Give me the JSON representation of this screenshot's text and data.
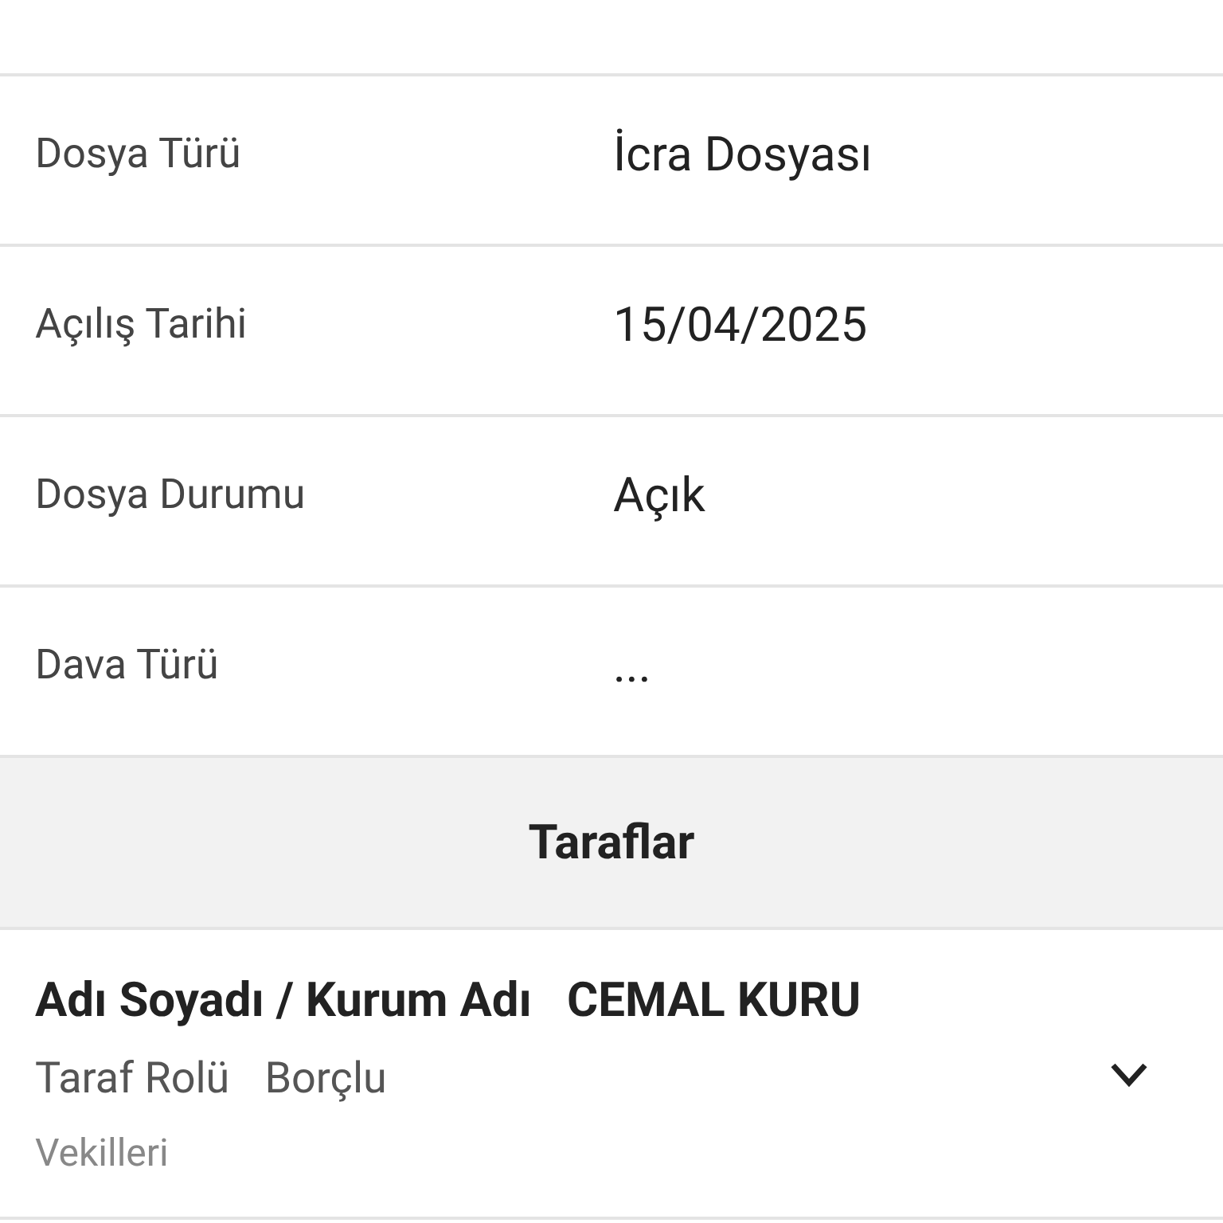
{
  "details": [
    {
      "label": "Dosya Türü",
      "value": "İcra Dosyası"
    },
    {
      "label": "Açılış Tarihi",
      "value": "15/04/2025"
    },
    {
      "label": "Dosya Durumu",
      "value": "Açık"
    },
    {
      "label": "Dava Türü",
      "value": "..."
    }
  ],
  "parties_header": "Taraflar",
  "parties": [
    {
      "name_label": "Adı Soyadı / Kurum Adı",
      "name": "CEMAL KURU",
      "role_label": "Taraf Rolü",
      "role": "Borçlu",
      "lawyers_label": "Vekilleri",
      "expanded": false
    }
  ]
}
